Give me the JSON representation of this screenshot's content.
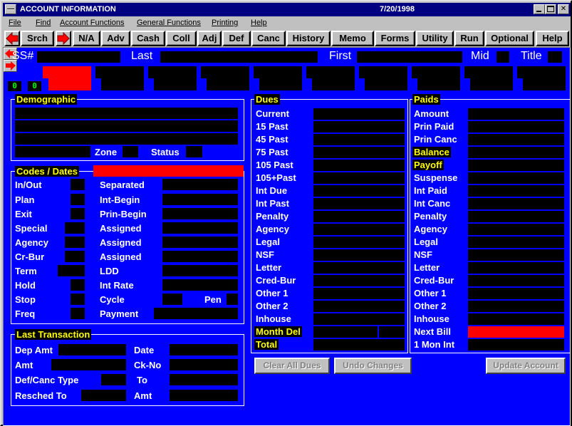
{
  "window": {
    "title": "ACCOUNT INFORMATION",
    "date": "7/20/1998",
    "icons": {
      "minimize": "minimize-icon",
      "maximize": "maximize-icon",
      "close": "close-icon"
    }
  },
  "menu": [
    "File",
    "Find",
    "Account Functions",
    "General Functions",
    "Printing",
    "Help"
  ],
  "toolbar": {
    "prev_icon": "left-arrow-icon",
    "next_icon": "right-arrow-icon",
    "buttons": [
      "Srch",
      "N/A",
      "Adv",
      "Cash",
      "Coll",
      "Adj",
      "Def",
      "Canc",
      "History",
      "Memo",
      "Forms",
      "Utility",
      "Run",
      "Optional",
      "Help"
    ]
  },
  "header": {
    "ssn_label": "SS#",
    "last_label": "Last",
    "first_label": "First",
    "mid_label": "Mid",
    "title_label": "Title",
    "counter_left": "0",
    "counter_right": "0"
  },
  "demographic": {
    "title": "Demographic",
    "zone_label": "Zone",
    "status_label": "Status"
  },
  "codes": {
    "title": "Codes / Dates",
    "left": [
      "In/Out",
      "Plan",
      "Exit",
      "Special",
      "Agency",
      "Cr-Bur",
      "Term",
      "Hold",
      "Stop",
      "Freq"
    ],
    "right": [
      "Separated",
      "Int-Begin",
      "Prin-Begin",
      "Assigned",
      "Assigned",
      "Assigned",
      "LDD",
      "Int Rate",
      "Cycle",
      "Payment"
    ],
    "pen_label": "Pen"
  },
  "last_transaction": {
    "title": "Last Transaction",
    "left": [
      "Dep Amt",
      "Amt",
      "Def/Canc Type",
      "Resched To"
    ],
    "right": [
      "Date",
      "Ck-No",
      "To",
      "Amt"
    ]
  },
  "dues": {
    "title": "Dues",
    "items": [
      "Current",
      "15 Past",
      "45 Past",
      "75 Past",
      "105 Past",
      "105+Past",
      "Int Due",
      "Int Past",
      "Penalty",
      "Agency",
      "Legal",
      "NSF",
      "Letter",
      "Cred-Bur",
      "Other 1",
      "Other 2",
      "Inhouse",
      "Month Del",
      "Total"
    ]
  },
  "paids": {
    "title": "Paids",
    "items": [
      "Amount",
      "Prin Paid",
      "Prin Canc",
      "Balance",
      "Payoff",
      "Suspense",
      "Int Paid",
      "Int Canc",
      "Penalty",
      "Agency",
      "Legal",
      "NSF",
      "Letter",
      "Cred-Bur",
      "Other 1",
      "Other 2",
      "Inhouse",
      "Next Bill",
      "1 Mon Int"
    ]
  },
  "actions": {
    "clear_dues": "Clear All Dues",
    "undo": "Undo Changes",
    "update": "Update Account"
  },
  "colors": {
    "panel": "#0000ff",
    "field": "#000000",
    "highlight": "#ffff00",
    "alert": "#ff0000",
    "titlebar": "#000080"
  }
}
